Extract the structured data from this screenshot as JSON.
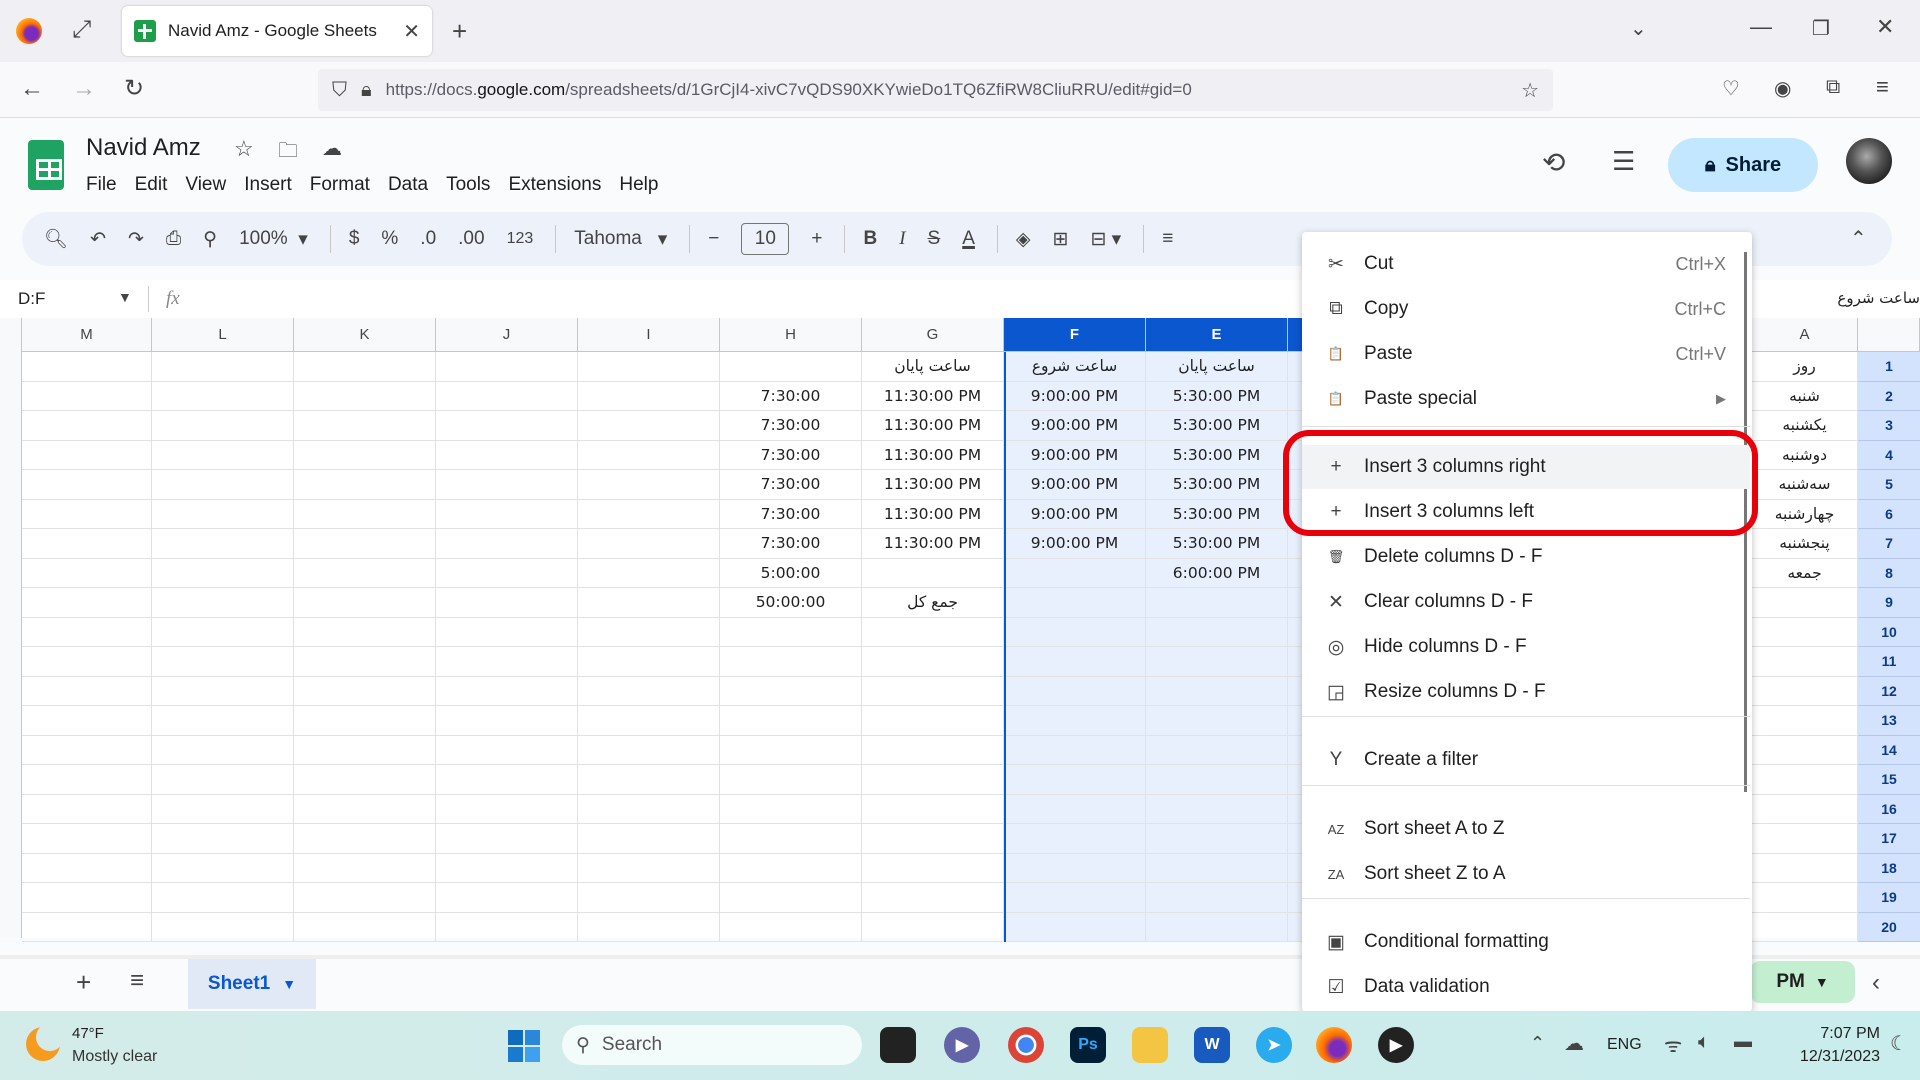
{
  "browser": {
    "tab_title": "Navid Amz - Google Sheets",
    "url_prefix": "https://docs.",
    "url_domain": "google.com",
    "url_suffix": "/spreadsheets/d/1GrCjI4-xivC7vQDS90XKYwieDo1TQ6ZfiRW8CliuRRU/edit#gid=0"
  },
  "app": {
    "doc_title": "Navid Amz",
    "menu": [
      "File",
      "Edit",
      "View",
      "Insert",
      "Format",
      "Data",
      "Tools",
      "Extensions",
      "Help"
    ],
    "share_label": "Share"
  },
  "toolbar": {
    "zoom": "100%",
    "currency": "$",
    "percent": "%",
    "dec_decrease": ".0",
    "dec_increase": ".00",
    "number_format": "123",
    "font": "Tahoma",
    "font_size": "10"
  },
  "formula_bar": {
    "name_box": "D:F",
    "fx": "fx",
    "content": "ساعت شروع"
  },
  "sheet": {
    "columns": [
      "M",
      "L",
      "K",
      "J",
      "I",
      "H",
      "G",
      "F",
      "E",
      "A"
    ],
    "selected_columns": [
      "F",
      "E"
    ],
    "rows": [
      "1",
      "2",
      "3",
      "4",
      "5",
      "6",
      "7",
      "8",
      "9",
      "10",
      "11",
      "12",
      "13",
      "14",
      "15",
      "16",
      "17",
      "18",
      "19",
      "20"
    ],
    "H": [
      "",
      "7:30:00",
      "7:30:00",
      "7:30:00",
      "7:30:00",
      "7:30:00",
      "7:30:00",
      "5:00:00",
      "50:00:00"
    ],
    "G": [
      "ساعت پایان",
      "11:30:00 PM",
      "11:30:00 PM",
      "11:30:00 PM",
      "11:30:00 PM",
      "11:30:00 PM",
      "11:30:00 PM",
      "",
      "جمع کل"
    ],
    "F": [
      "ساعت شروع",
      "9:00:00 PM",
      "9:00:00 PM",
      "9:00:00 PM",
      "9:00:00 PM",
      "9:00:00 PM",
      "9:00:00 PM",
      "",
      ""
    ],
    "E": [
      "ساعت پایان",
      "5:30:00 PM",
      "5:30:00 PM",
      "5:30:00 PM",
      "5:30:00 PM",
      "5:30:00 PM",
      "5:30:00 PM",
      "6:00:00 PM",
      ""
    ],
    "A": [
      "روز",
      "شنبه",
      "یکشنبه",
      "دوشنبه",
      "سه‌شنبه",
      "چهارشنبه",
      "پنجشنبه",
      "جمعه",
      ""
    ]
  },
  "context_menu": {
    "items": [
      {
        "label": "Cut",
        "shortcut": "Ctrl+X",
        "icon": "scissors-icon",
        "glyph": "✂"
      },
      {
        "label": "Copy",
        "shortcut": "Ctrl+C",
        "icon": "copy-icon",
        "glyph": "⧉"
      },
      {
        "label": "Paste",
        "shortcut": "Ctrl+V",
        "icon": "clipboard-icon",
        "glyph": "📋"
      },
      {
        "label": "Paste special",
        "shortcut": "▶",
        "icon": "clipboard-icon",
        "glyph": "📋"
      },
      {
        "label": "Insert 3 columns right",
        "shortcut": "",
        "icon": "plus-icon",
        "glyph": "+"
      },
      {
        "label": "Insert 3 columns left",
        "shortcut": "",
        "icon": "plus-icon",
        "glyph": "+"
      },
      {
        "label": "Delete columns D - F",
        "shortcut": "",
        "icon": "trash-icon",
        "glyph": "🗑"
      },
      {
        "label": "Clear columns D - F",
        "shortcut": "",
        "icon": "close-icon",
        "glyph": "✕"
      },
      {
        "label": "Hide columns D - F",
        "shortcut": "",
        "icon": "eye-off-icon",
        "glyph": "◎"
      },
      {
        "label": "Resize columns D - F",
        "shortcut": "",
        "icon": "resize-icon",
        "glyph": "◲"
      },
      {
        "label": "Create a filter",
        "shortcut": "",
        "icon": "filter-icon",
        "glyph": "Y"
      },
      {
        "label": "Sort sheet A to Z",
        "shortcut": "",
        "icon": "sort-az-icon",
        "glyph": "AZ"
      },
      {
        "label": "Sort sheet Z to A",
        "shortcut": "",
        "icon": "sort-za-icon",
        "glyph": "ZA"
      },
      {
        "label": "Conditional formatting",
        "shortcut": "",
        "icon": "paint-roller-icon",
        "glyph": "▣"
      },
      {
        "label": "Data validation",
        "shortcut": "",
        "icon": "data-validation-icon",
        "glyph": "☑"
      }
    ]
  },
  "bottom": {
    "sheet_tab": "Sheet1",
    "summary_chip": "PM"
  },
  "taskbar": {
    "temperature": "47°F",
    "weather": "Mostly clear",
    "search_placeholder": "Search",
    "language": "ENG",
    "time": "7:07 PM",
    "date": "12/31/2023"
  }
}
